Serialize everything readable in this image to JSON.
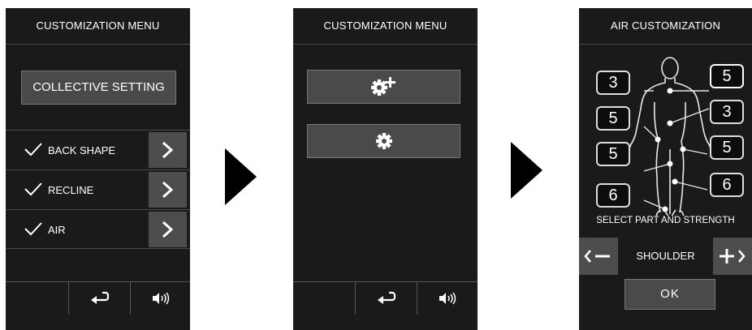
{
  "screen1": {
    "title": "CUSTOMIZATION MENU",
    "collective_label": "COLLECTIVE SETTING",
    "rows": [
      {
        "label": "BACK SHAPE"
      },
      {
        "label": "RECLINE"
      },
      {
        "label": "AIR"
      }
    ],
    "bottom_icons": [
      "blank",
      "return-icon",
      "speaker-icon"
    ]
  },
  "screen2": {
    "title": "CUSTOMIZATION MENU",
    "buttons": [
      "gear-plus-icon",
      "gear-icon"
    ],
    "bottom_icons": [
      "blank",
      "return-icon",
      "speaker-icon"
    ]
  },
  "screen3": {
    "title": "AIR CUSTOMIZATION",
    "left_values": [
      "3",
      "5",
      "5",
      "6"
    ],
    "right_values": [
      "5",
      "3",
      "5",
      "6"
    ],
    "instruction": "SELECT PART AND STRENGTH",
    "selected_part": "SHOULDER",
    "ok_label": "OK"
  },
  "colors": {
    "screen_bg": "#1a1a1a",
    "button_bg": "#4a4a4a",
    "text": "#ffffff",
    "arrow": "#000000"
  }
}
